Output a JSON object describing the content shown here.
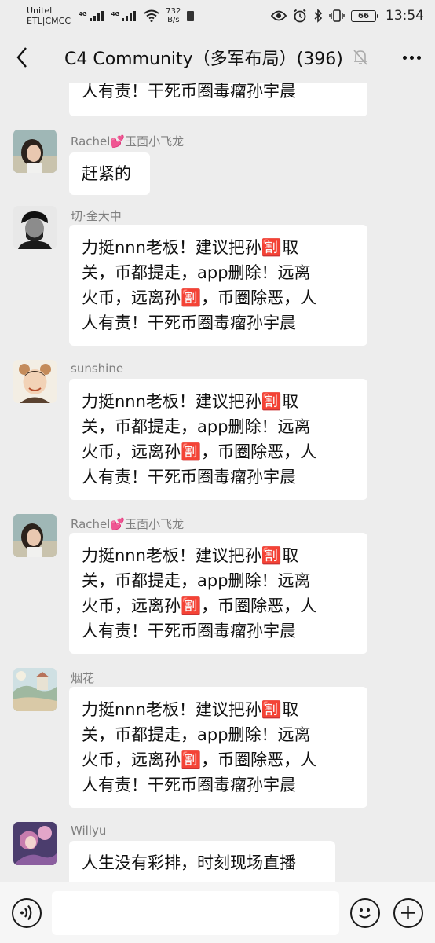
{
  "status": {
    "carrier_line1": "Unitel",
    "carrier_line2": "ETL|CMCC",
    "sig1_label": "4G",
    "sig2_label": "4G",
    "speed_value": "732",
    "speed_unit": "B/s",
    "battery": "66",
    "time": "13:54"
  },
  "header": {
    "title": "C4 Community（多军布局）(396)",
    "icons": [
      "back-icon",
      "mute-bell-icon",
      "more-icon"
    ]
  },
  "messages": [
    {
      "sender": "",
      "lines": [
        "人有责！干死币圈毒瘤孙宇晨"
      ],
      "partial": true
    },
    {
      "sender": "Rachel💕玉面小飞龙",
      "avatar": "girl-portrait",
      "lines": [
        "赶紧的"
      ]
    },
    {
      "sender": "切·金大中",
      "avatar": "che-portrait",
      "lines": [
        "力挺nnn老板！建议把孙🈹取",
        "关，币都提走，app删除！远离",
        "火币，远离孙🈹，币圈除恶，人",
        "人有责！干死币圈毒瘤孙宇晨"
      ]
    },
    {
      "sender": "sunshine",
      "avatar": "child-portrait",
      "lines": [
        "力挺nnn老板！建议把孙🈹取",
        "关，币都提走，app删除！远离",
        "火币，远离孙🈹，币圈除恶，人",
        "人有责！干死币圈毒瘤孙宇晨"
      ]
    },
    {
      "sender": "Rachel💕玉面小飞龙",
      "avatar": "girl-portrait",
      "lines": [
        "力挺nnn老板！建议把孙🈹取",
        "关，币都提走，app删除！远离",
        "火币，远离孙🈹，币圈除恶，人",
        "人有责！干死币圈毒瘤孙宇晨"
      ]
    },
    {
      "sender": "烟花",
      "avatar": "landscape-painting",
      "lines": [
        "力挺nnn老板！建议把孙🈹取",
        "关，币都提走，app删除！远离",
        "火币，远离孙🈹，币圈除恶，人",
        "人有责！干死币圈毒瘤孙宇晨"
      ]
    },
    {
      "sender": "Willyu",
      "avatar": "anime-portrait",
      "lines": [
        "人生没有彩排，时刻现场直播"
      ]
    }
  ],
  "input": {
    "value": "",
    "icons": [
      "voice-icon",
      "emoji-icon",
      "plus-icon"
    ]
  },
  "colors": {
    "background": "#ededed",
    "bubble": "#ffffff",
    "sender_name": "#808080",
    "input_bar": "#f6f6f6"
  }
}
